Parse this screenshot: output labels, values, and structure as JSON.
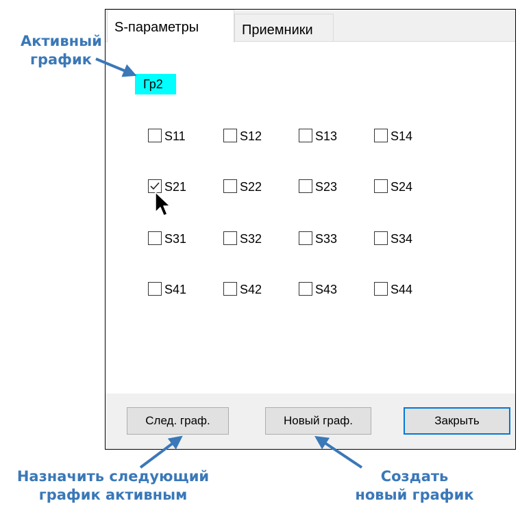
{
  "annotations": {
    "active_graph_line1": "Активный",
    "active_graph_line2": "график",
    "next_graph_line1": "Назначить следующий",
    "next_graph_line2": "график активным",
    "new_graph_line1": "Создать",
    "new_graph_line2": "новый график",
    "color": "#3a78b8"
  },
  "dialog": {
    "tabs": [
      {
        "label": "S-параметры",
        "active": true
      },
      {
        "label": "Приемники",
        "active": false
      }
    ],
    "active_graph": {
      "label": "Гр2",
      "background": "#00ffff"
    },
    "s_params": [
      [
        {
          "label": "S11",
          "checked": false
        },
        {
          "label": "S12",
          "checked": false
        },
        {
          "label": "S13",
          "checked": false
        },
        {
          "label": "S14",
          "checked": false
        }
      ],
      [
        {
          "label": "S21",
          "checked": true
        },
        {
          "label": "S22",
          "checked": false
        },
        {
          "label": "S23",
          "checked": false
        },
        {
          "label": "S24",
          "checked": false
        }
      ],
      [
        {
          "label": "S31",
          "checked": false
        },
        {
          "label": "S32",
          "checked": false
        },
        {
          "label": "S33",
          "checked": false
        },
        {
          "label": "S34",
          "checked": false
        }
      ],
      [
        {
          "label": "S41",
          "checked": false
        },
        {
          "label": "S42",
          "checked": false
        },
        {
          "label": "S43",
          "checked": false
        },
        {
          "label": "S44",
          "checked": false
        }
      ]
    ],
    "buttons": {
      "next": "След. граф.",
      "new": "Новый граф.",
      "close": "Закрыть"
    }
  }
}
